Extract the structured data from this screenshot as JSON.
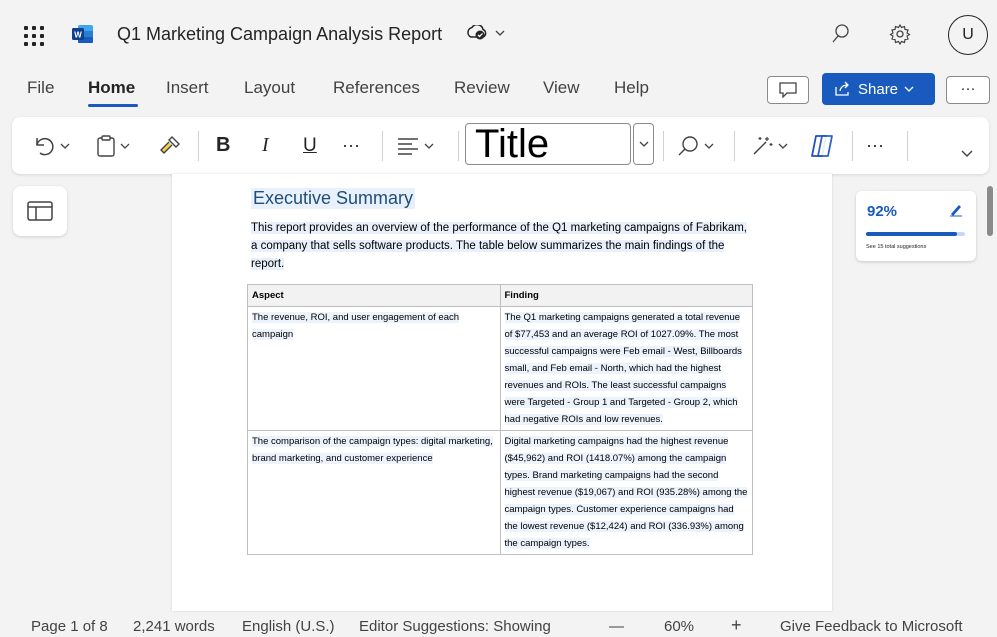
{
  "app": {
    "doc_title": "Q1 Marketing Campaign Analysis Report",
    "avatar_initial": "U"
  },
  "menu": {
    "tabs": [
      "File",
      "Home",
      "Insert",
      "Layout",
      "References",
      "Review",
      "View",
      "Help"
    ],
    "active_tab": "Home",
    "share_label": "Share",
    "more_label": "···"
  },
  "ribbon": {
    "bold": "B",
    "italic": "I",
    "underline": "U",
    "more": "···",
    "style_value": "Title",
    "overflow": "···"
  },
  "document": {
    "heading": "Executive Summary",
    "intro": "This report provides an overview of the performance of the Q1 marketing campaigns of Fabrikam, a company that sells software products. The table below summarizes the main findings of the report.",
    "table": {
      "headers": [
        "Aspect",
        "Finding"
      ],
      "rows": [
        {
          "aspect": "The revenue, ROI, and user engagement of each campaign",
          "finding": "The Q1 marketing campaigns generated a total revenue of $77,453 and an average ROI of 1027.09%. The most successful campaigns were Feb email - West, Billboards small, and Feb email - North, which had the highest revenues and ROIs. The least successful campaigns were Targeted - Group 1 and Targeted - Group 2, which had negative ROIs and low revenues."
        },
        {
          "aspect": "The comparison of the campaign types: digital marketing, brand marketing, and customer experience",
          "finding": "Digital marketing campaigns had the highest revenue ($45,962) and ROI (1418.07%) among the campaign types. Brand marketing campaigns had the second highest revenue ($19,067) and ROI (935.28%) among the campaign types. Customer experience campaigns had the lowest revenue ($12,424) and ROI (336.93%) among the campaign types."
        }
      ]
    }
  },
  "editor": {
    "score": "92%",
    "score_fraction": 0.92,
    "subtitle": "See 15 total suggestions"
  },
  "status": {
    "page": "Page 1 of 8",
    "words": "2,241 words",
    "language": "English (U.S.)",
    "editor": "Editor Suggestions: Showing",
    "zoom_out": "—",
    "zoom": "60%",
    "zoom_in": "+",
    "feedback": "Give Feedback to Microsoft"
  },
  "colors": {
    "accent": "#185abd",
    "heading": "#1f4e79"
  }
}
